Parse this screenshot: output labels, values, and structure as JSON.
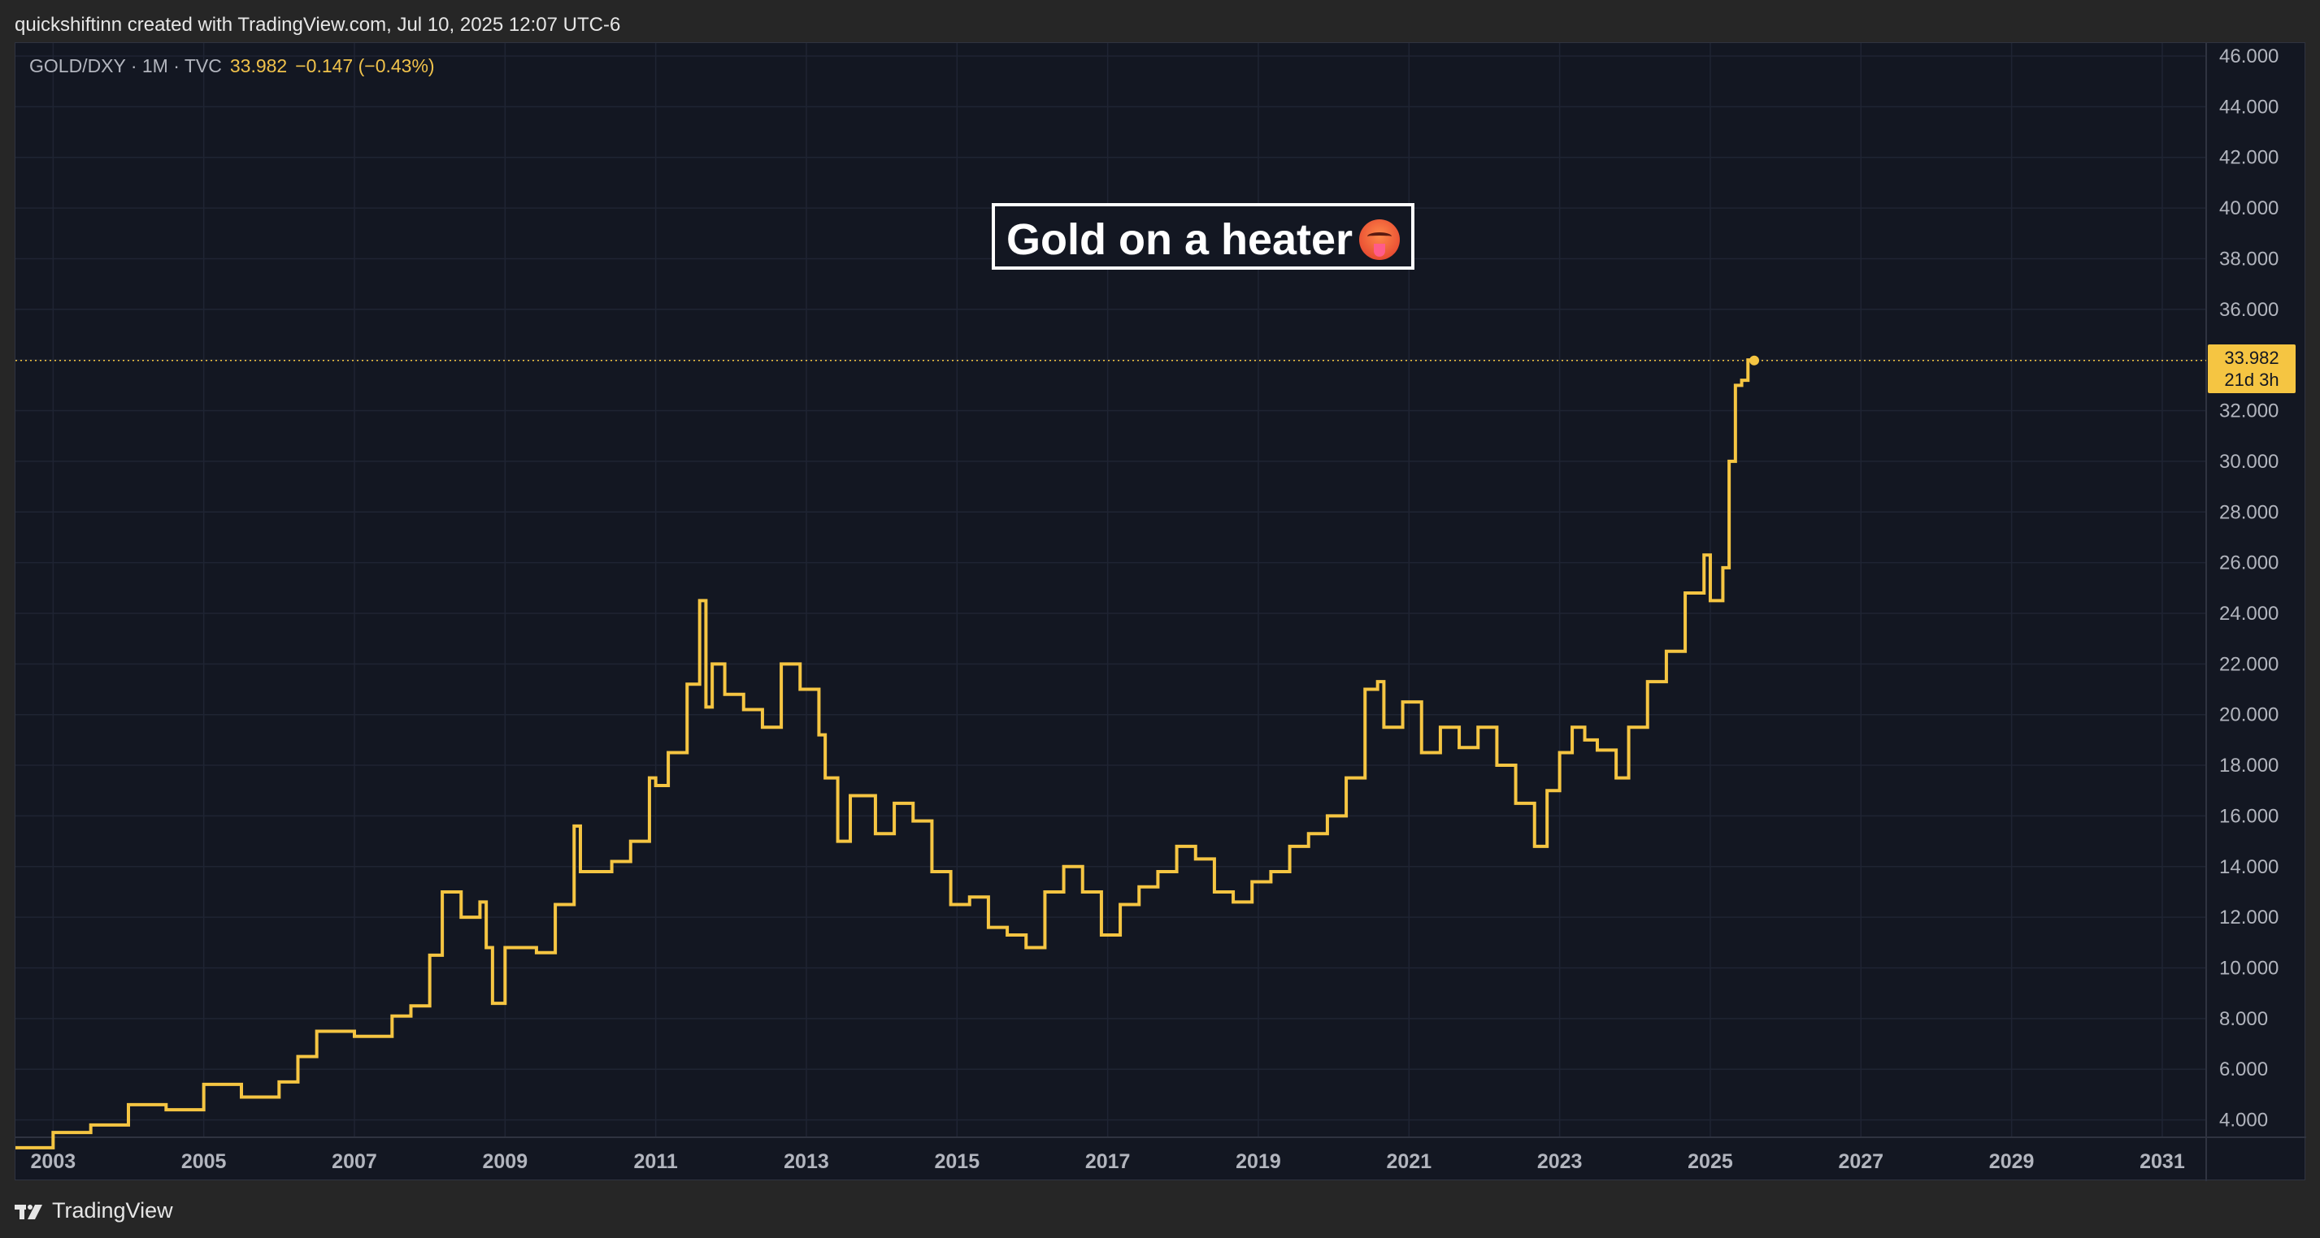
{
  "header": {
    "attribution": "quickshiftinn created with TradingView.com, Jul 10, 2025 12:07 UTC-6"
  },
  "legend": {
    "symbol": "GOLD/DXY · 1M · TVC",
    "last": "33.982",
    "change": "−0.147 (−0.43%)"
  },
  "annotation": {
    "text": "Gold on a heater"
  },
  "price_tag": {
    "price": "33.982",
    "countdown": "21d 3h"
  },
  "footer": {
    "brand": "TradingView"
  },
  "colors": {
    "background": "#131722",
    "line": "#f5c542",
    "grid": "#1f2433",
    "axis_text": "#b2b5be"
  },
  "icons": {
    "footer_logo": "tradingview-logo-icon",
    "annotation_emoji": "hot-face-emoji-icon"
  },
  "chart_data": {
    "type": "line",
    "line_style": "step",
    "series": [
      {
        "x": [
          "2002-07",
          "2003-01",
          "2003-07",
          "2004-01",
          "2004-07",
          "2005-01",
          "2005-07",
          "2006-01",
          "2006-04",
          "2006-07",
          "2007-01",
          "2007-07",
          "2007-10",
          "2008-01",
          "2008-03",
          "2008-06",
          "2008-09",
          "2008-10",
          "2008-11",
          "2009-01",
          "2009-06",
          "2009-09",
          "2009-12",
          "2010-01",
          "2010-06",
          "2010-09",
          "2010-12",
          "2011-01",
          "2011-03",
          "2011-06",
          "2011-08",
          "2011-09",
          "2011-10",
          "2011-12",
          "2012-03",
          "2012-06",
          "2012-09",
          "2012-12",
          "2013-03",
          "2013-04",
          "2013-06",
          "2013-08",
          "2013-12",
          "2014-03",
          "2014-06",
          "2014-09",
          "2014-12",
          "2015-03",
          "2015-06",
          "2015-09",
          "2015-12",
          "2016-03",
          "2016-06",
          "2016-09",
          "2016-12",
          "2017-03",
          "2017-06",
          "2017-09",
          "2017-12",
          "2018-03",
          "2018-06",
          "2018-09",
          "2018-12",
          "2019-03",
          "2019-06",
          "2019-09",
          "2019-12",
          "2020-03",
          "2020-06",
          "2020-08",
          "2020-09",
          "2020-12",
          "2021-03",
          "2021-06",
          "2021-09",
          "2021-12",
          "2022-03",
          "2022-06",
          "2022-09",
          "2022-11",
          "2023-01",
          "2023-03",
          "2023-05",
          "2023-07",
          "2023-10",
          "2023-12",
          "2024-03",
          "2024-06",
          "2024-09",
          "2024-12",
          "2025-01",
          "2025-03",
          "2025-04",
          "2025-05",
          "2025-06",
          "2025-07"
        ],
        "y": [
          2.9,
          3.5,
          3.8,
          4.6,
          4.4,
          5.4,
          4.9,
          5.5,
          6.5,
          7.5,
          7.3,
          8.1,
          8.5,
          10.5,
          13.0,
          12.0,
          12.6,
          10.8,
          8.6,
          10.8,
          10.6,
          12.5,
          15.6,
          13.8,
          14.2,
          15.0,
          17.5,
          17.2,
          18.5,
          21.2,
          24.5,
          20.3,
          22.0,
          20.8,
          20.2,
          19.5,
          22.0,
          21.0,
          19.2,
          17.5,
          15.0,
          16.8,
          15.3,
          16.5,
          15.8,
          13.8,
          12.5,
          12.8,
          11.6,
          11.3,
          10.8,
          13.0,
          14.0,
          13.0,
          11.3,
          12.5,
          13.2,
          13.8,
          14.8,
          14.3,
          13.0,
          12.6,
          13.4,
          13.8,
          14.8,
          15.3,
          16.0,
          17.5,
          21.0,
          21.3,
          19.5,
          20.5,
          18.5,
          19.5,
          18.7,
          19.5,
          18.0,
          16.5,
          14.8,
          17.0,
          18.5,
          19.5,
          19.0,
          18.6,
          17.5,
          19.5,
          21.3,
          22.5,
          24.8,
          26.3,
          24.5,
          25.8,
          30.0,
          33.0,
          33.2,
          34.0
        ]
      }
    ],
    "last_value": 33.982,
    "ylim": [
      2.8,
      46.0
    ],
    "xlim": [
      "2002-07",
      "2031-08"
    ],
    "y_ticks": [
      "4.000",
      "6.000",
      "8.000",
      "10.000",
      "12.000",
      "14.000",
      "16.000",
      "18.000",
      "20.000",
      "22.000",
      "24.000",
      "26.000",
      "28.000",
      "30.000",
      "32.000",
      "34.000",
      "36.000",
      "38.000",
      "40.000",
      "42.000",
      "44.000",
      "46.000"
    ],
    "x_ticks": [
      "2003",
      "2005",
      "2007",
      "2009",
      "2011",
      "2013",
      "2015",
      "2017",
      "2019",
      "2021",
      "2023",
      "2025",
      "2027",
      "2029",
      "2031"
    ],
    "grid": true,
    "price_line": "dotted"
  }
}
